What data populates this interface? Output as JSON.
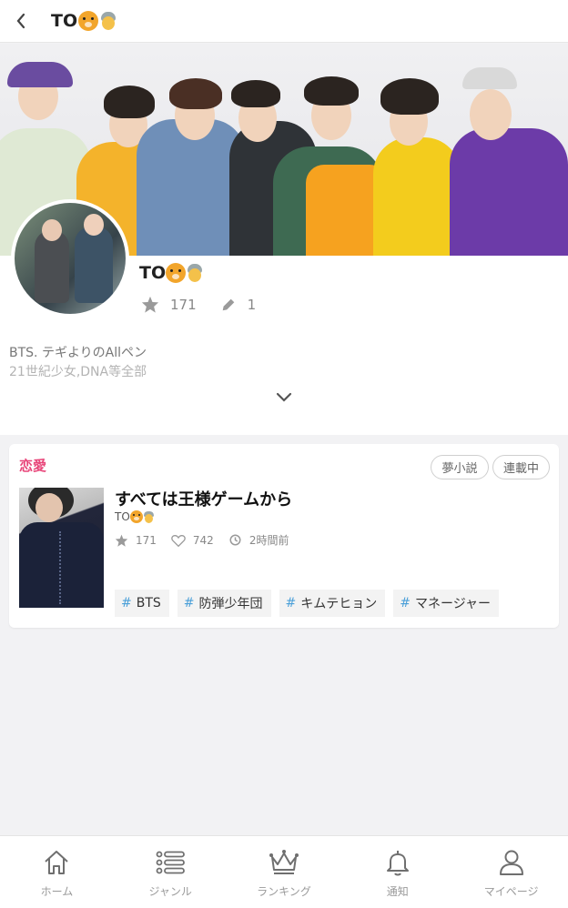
{
  "header": {
    "title": "TO"
  },
  "profile": {
    "name": "TO",
    "stars": "171",
    "works": "1",
    "bio_line1": "BTS. テギよりのAllペン",
    "bio_line2": "21世紀少女,DNA等全部"
  },
  "story": {
    "genre": "恋愛",
    "badges": [
      "夢小説",
      "連載中"
    ],
    "title": "すべては王様ゲームから",
    "author": "TO",
    "stars": "171",
    "likes": "742",
    "updated": "2時間前",
    "tags": [
      "BTS",
      "防弾少年団",
      "キムテヒョン",
      "マネージャー"
    ]
  },
  "nav": {
    "items": [
      {
        "label": "ホーム",
        "icon": "home-icon"
      },
      {
        "label": "ジャンル",
        "icon": "list-icon"
      },
      {
        "label": "ランキング",
        "icon": "crown-icon"
      },
      {
        "label": "通知",
        "icon": "bell-icon"
      },
      {
        "label": "マイページ",
        "icon": "person-icon"
      }
    ]
  },
  "colors": {
    "genre": "#e8467a",
    "tag_hash": "#4a9fd8",
    "nav_icon": "#6f6f6f"
  }
}
